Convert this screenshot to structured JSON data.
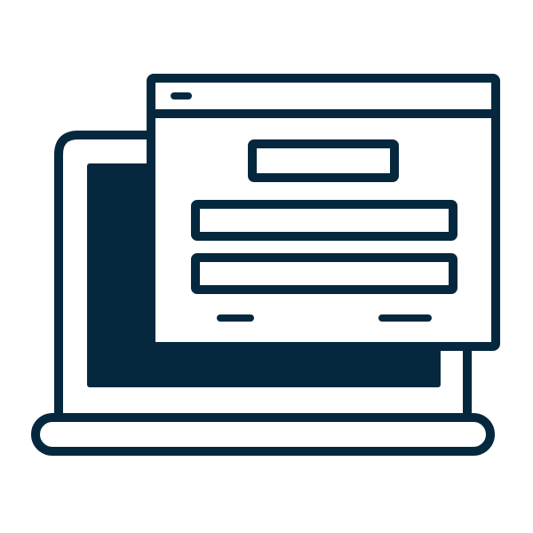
{
  "illustration": {
    "subject": "laptop-with-login-window",
    "stroke_color": "#06283F",
    "fill_color": "#FFFFFF",
    "background_color": "#FFFFFF"
  },
  "icons": {
    "laptop": "laptop-icon",
    "login_window": "login-window-icon"
  }
}
